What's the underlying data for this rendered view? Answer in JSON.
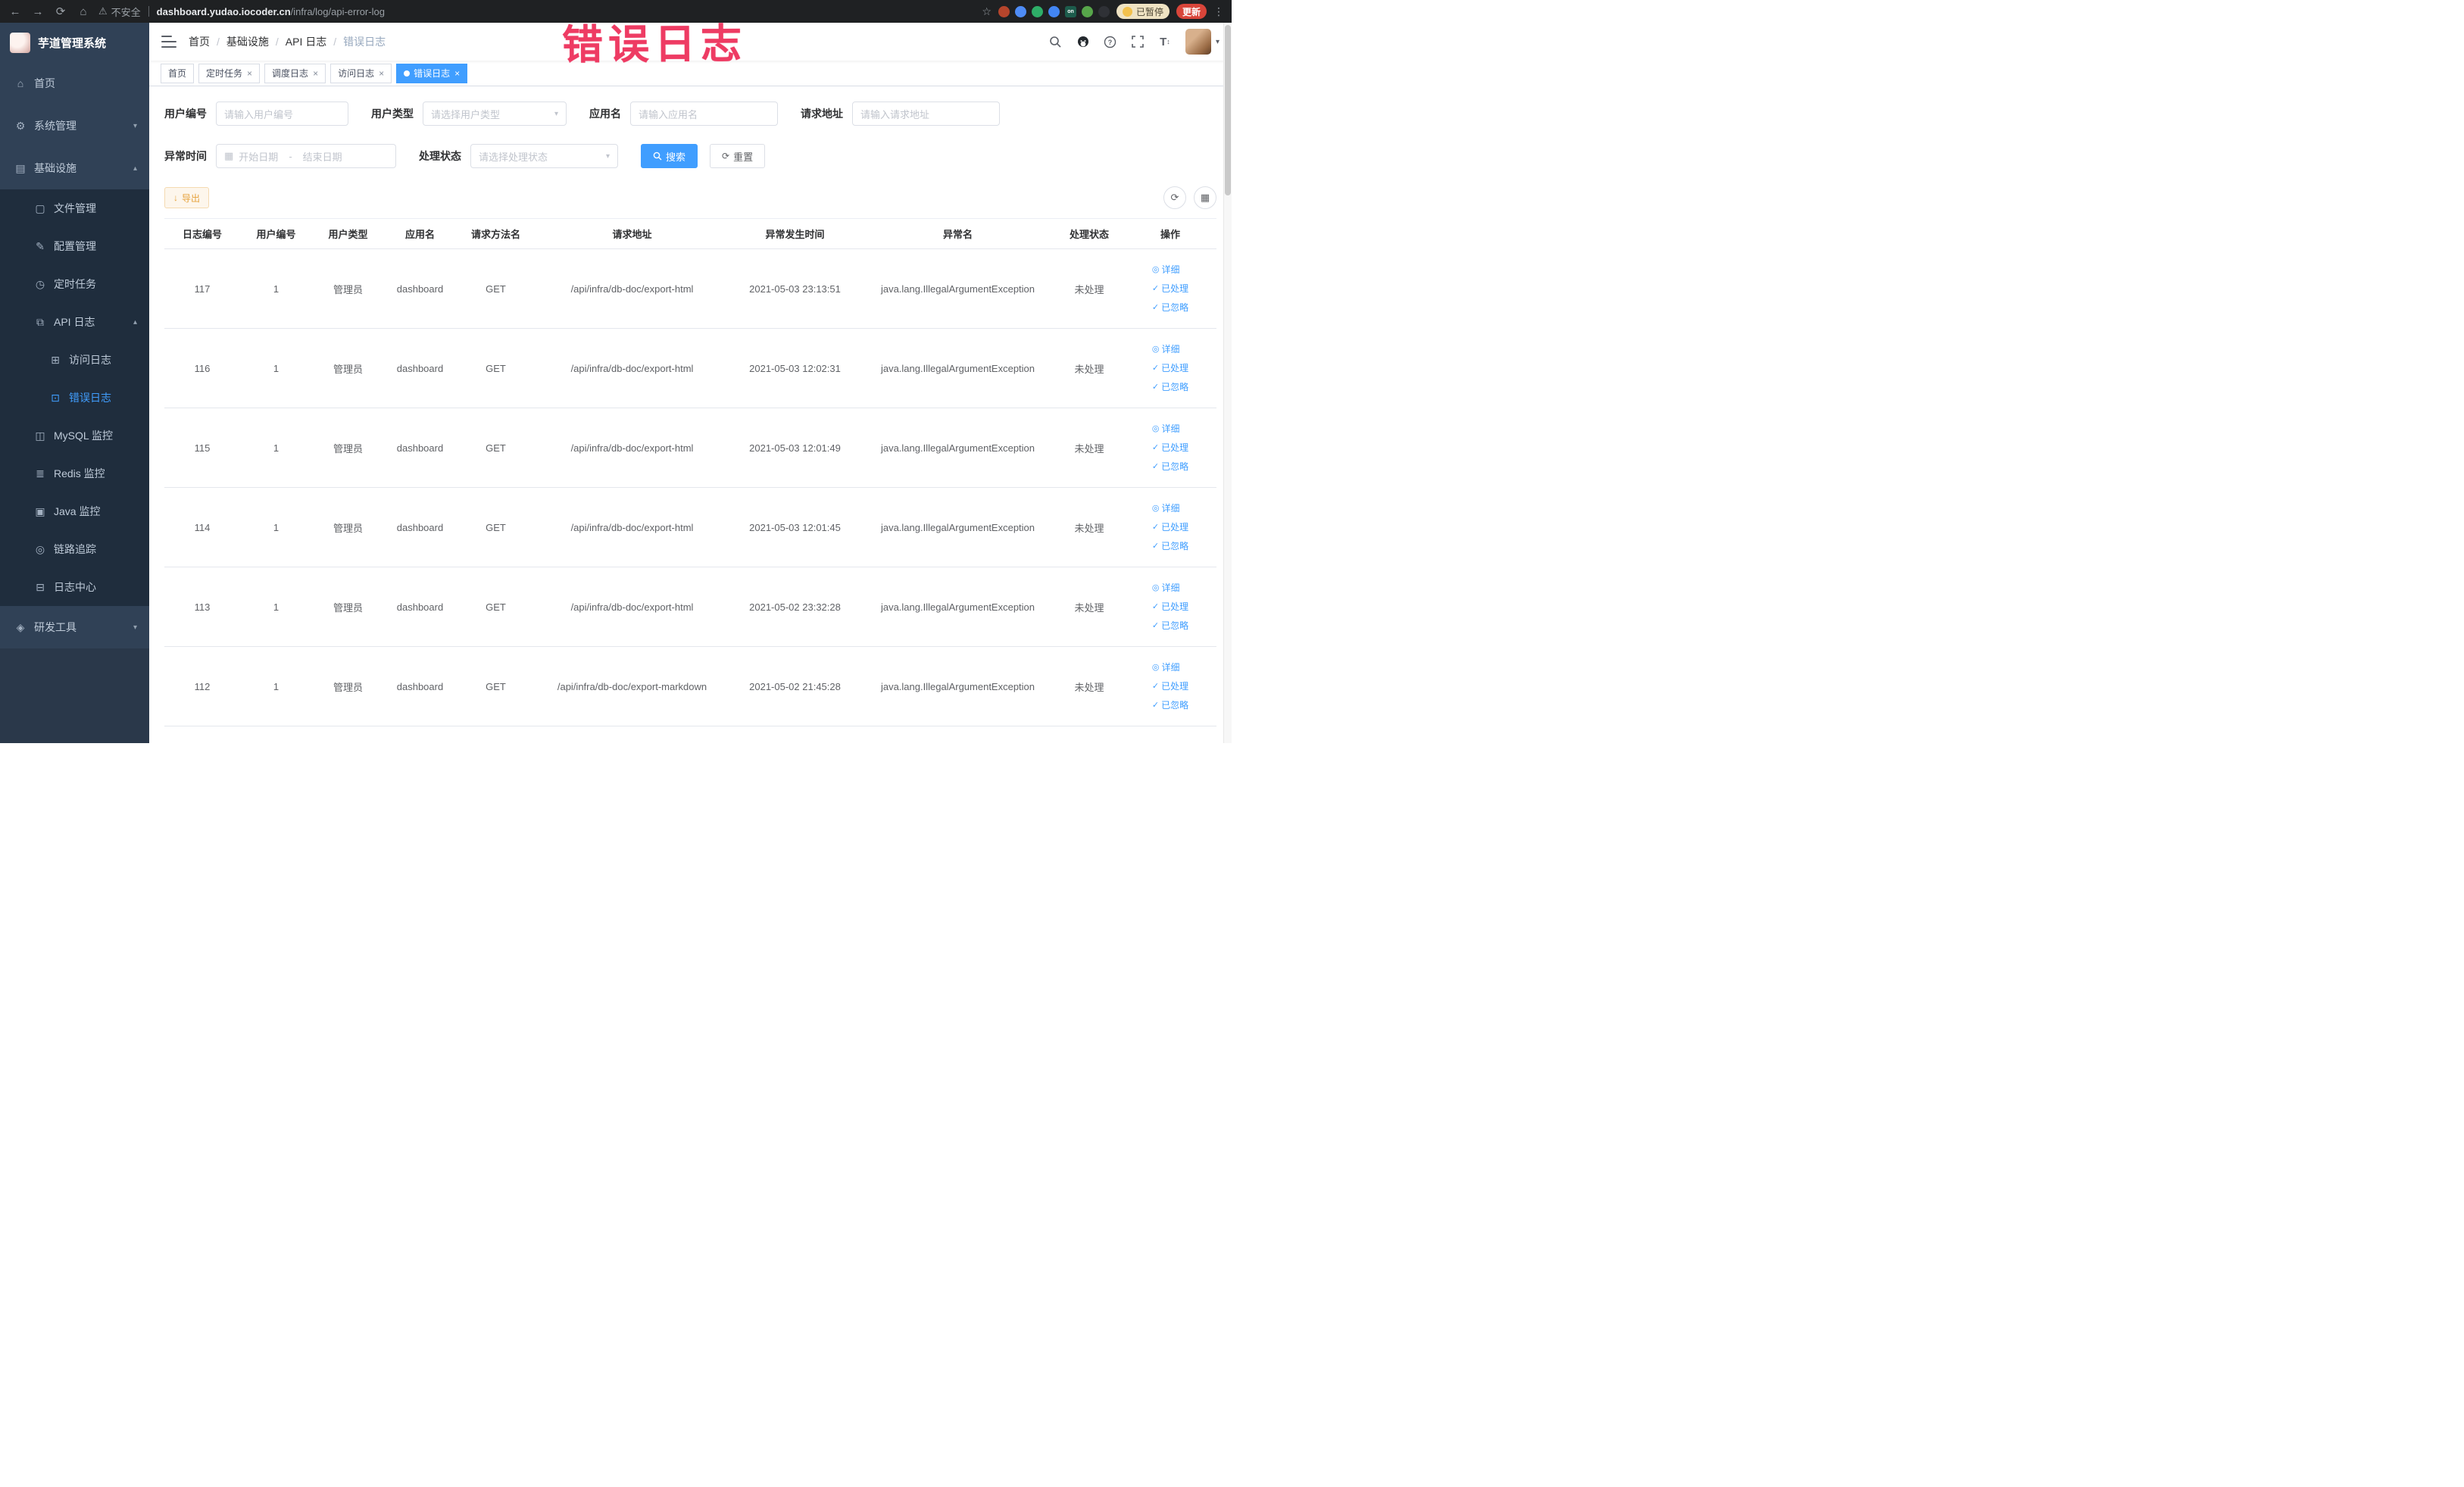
{
  "colors": {
    "primary": "#409eff",
    "warning": "#e6a23c",
    "annotation": "#ee3b63",
    "sidebar-bg": "#304156",
    "submenu-bg": "#1f2d3d",
    "active-tab": "#409eff"
  },
  "browser": {
    "security_label": "不安全",
    "url_host": "dashboard.yudao.iocoder.cn",
    "url_path": "/infra/log/api-error-log",
    "paused_badge": "已暂停",
    "update_button": "更新",
    "extensions": [
      {
        "name": "extension-icon-1",
        "color": "#b6452c",
        "label": ""
      },
      {
        "name": "extension-icon-2",
        "color": "#4e8cf7",
        "label": ""
      },
      {
        "name": "extension-icon-3",
        "color": "#2eae68",
        "label": ""
      },
      {
        "name": "extension-icon-4",
        "color": "#4285f4",
        "label": ""
      },
      {
        "name": "extension-icon-5",
        "color": "#1d5c4c",
        "label": "on"
      },
      {
        "name": "extension-icon-6",
        "color": "#57a64a",
        "label": ""
      },
      {
        "name": "extension-icon-7",
        "color": "#2f3136",
        "label": ""
      }
    ]
  },
  "annotation": "错误日志",
  "sidebar": {
    "logo_title": "芋道管理系统",
    "items": [
      {
        "name": "home",
        "label": "首页",
        "icon": "home-icon",
        "level": 0
      },
      {
        "name": "system-management",
        "label": "系统管理",
        "icon": "gear-icon",
        "level": 0,
        "chevron": "down"
      },
      {
        "name": "infrastructure",
        "label": "基础设施",
        "icon": "infra-icon",
        "level": 0,
        "chevron": "up"
      },
      {
        "name": "file-management",
        "label": "文件管理",
        "icon": "file-icon",
        "level": 1
      },
      {
        "name": "config-management",
        "label": "配置管理",
        "icon": "config-icon",
        "level": 1
      },
      {
        "name": "scheduled-tasks",
        "label": "定时任务",
        "icon": "timer-icon",
        "level": 1
      },
      {
        "name": "api-logs",
        "label": "API 日志",
        "icon": "api-log-icon",
        "level": 1,
        "chevron": "up"
      },
      {
        "name": "access-log",
        "label": "访问日志",
        "icon": "access-log-icon",
        "level": 2
      },
      {
        "name": "error-log",
        "label": "错误日志",
        "icon": "error-log-icon",
        "level": 2,
        "active": true
      },
      {
        "name": "mysql-monitor",
        "label": "MySQL 监控",
        "icon": "mysql-icon",
        "level": 1
      },
      {
        "name": "redis-monitor",
        "label": "Redis 监控",
        "icon": "redis-icon",
        "level": 1
      },
      {
        "name": "java-monitor",
        "label": "Java 监控",
        "icon": "java-icon",
        "level": 1
      },
      {
        "name": "link-tracing",
        "label": "链路追踪",
        "icon": "trace-icon",
        "level": 1
      },
      {
        "name": "log-center",
        "label": "日志中心",
        "icon": "log-center-icon",
        "level": 1
      },
      {
        "name": "dev-tools",
        "label": "研发工具",
        "icon": "devtools-icon",
        "level": 0,
        "chevron": "down"
      }
    ]
  },
  "header": {
    "breadcrumb": [
      "首页",
      "基础设施",
      "API 日志",
      "错误日志"
    ],
    "icons": [
      "search-icon",
      "github-icon",
      "help-icon",
      "fullscreen-icon",
      "font-size-icon"
    ]
  },
  "tabs": [
    {
      "name": "home",
      "label": "首页",
      "closable": false,
      "active": false
    },
    {
      "name": "scheduled-tasks",
      "label": "定时任务",
      "closable": true,
      "active": false
    },
    {
      "name": "schedule-log",
      "label": "调度日志",
      "closable": true,
      "active": false
    },
    {
      "name": "access-log",
      "label": "访问日志",
      "closable": true,
      "active": false
    },
    {
      "name": "error-log",
      "label": "错误日志",
      "closable": true,
      "active": true
    }
  ],
  "filters": {
    "user_id": {
      "label": "用户编号",
      "placeholder": "请输入用户编号"
    },
    "user_type": {
      "label": "用户类型",
      "placeholder": "请选择用户类型"
    },
    "app_name": {
      "label": "应用名",
      "placeholder": "请输入应用名"
    },
    "request_url": {
      "label": "请求地址",
      "placeholder": "请输入请求地址"
    },
    "exception_time": {
      "label": "异常时间",
      "start_placeholder": "开始日期",
      "separator": "-",
      "end_placeholder": "结束日期"
    },
    "process_status": {
      "label": "处理状态",
      "placeholder": "请选择处理状态"
    },
    "search_label": "搜索",
    "reset_label": "重置"
  },
  "toolbar": {
    "export_label": "导出"
  },
  "table": {
    "columns": [
      "日志编号",
      "用户编号",
      "用户类型",
      "应用名",
      "请求方法名",
      "请求地址",
      "异常发生时间",
      "异常名",
      "处理状态",
      "操作"
    ],
    "row_actions": {
      "detail": "详细",
      "processed": "已处理",
      "ignored": "已忽略"
    },
    "rows": [
      {
        "id": "117",
        "user_id": "1",
        "user_type": "管理员",
        "app": "dashboard",
        "method": "GET",
        "url": "/api/infra/db-doc/export-html",
        "time": "2021-05-03 23:13:51",
        "exception": "java.lang.IllegalArgumentException",
        "status": "未处理"
      },
      {
        "id": "116",
        "user_id": "1",
        "user_type": "管理员",
        "app": "dashboard",
        "method": "GET",
        "url": "/api/infra/db-doc/export-html",
        "time": "2021-05-03 12:02:31",
        "exception": "java.lang.IllegalArgumentException",
        "status": "未处理"
      },
      {
        "id": "115",
        "user_id": "1",
        "user_type": "管理员",
        "app": "dashboard",
        "method": "GET",
        "url": "/api/infra/db-doc/export-html",
        "time": "2021-05-03 12:01:49",
        "exception": "java.lang.IllegalArgumentException",
        "status": "未处理"
      },
      {
        "id": "114",
        "user_id": "1",
        "user_type": "管理员",
        "app": "dashboard",
        "method": "GET",
        "url": "/api/infra/db-doc/export-html",
        "time": "2021-05-03 12:01:45",
        "exception": "java.lang.IllegalArgumentException",
        "status": "未处理"
      },
      {
        "id": "113",
        "user_id": "1",
        "user_type": "管理员",
        "app": "dashboard",
        "method": "GET",
        "url": "/api/infra/db-doc/export-html",
        "time": "2021-05-02 23:32:28",
        "exception": "java.lang.IllegalArgumentException",
        "status": "未处理"
      },
      {
        "id": "112",
        "user_id": "1",
        "user_type": "管理员",
        "app": "dashboard",
        "method": "GET",
        "url": "/api/infra/db-doc/export-markdown",
        "time": "2021-05-02 21:45:28",
        "exception": "java.lang.IllegalArgumentException",
        "status": "未处理"
      }
    ]
  }
}
